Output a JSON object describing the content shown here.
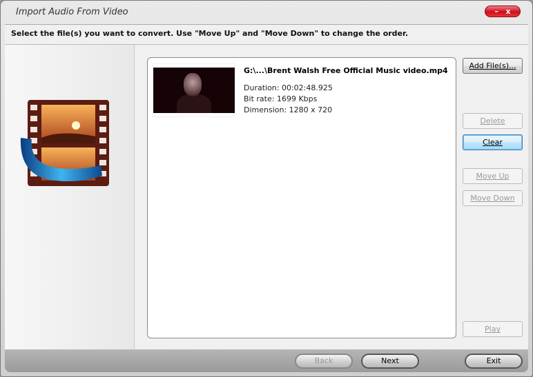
{
  "window": {
    "title": "Import Audio From Video",
    "minimize_label": "–",
    "close_label": "x"
  },
  "instruction": "Select the file(s) you want to convert. Use \"Move Up\" and \"Move Down\" to change the order.",
  "files": [
    {
      "name": "G:\\...\\Brent Walsh  Free Official Music video.mp4",
      "duration": "Duration: 00:02:48.925",
      "bitrate": "Bit rate: 1699 Kbps",
      "dimension": "Dimension: 1280 x 720"
    }
  ],
  "buttons": {
    "add": "Add File(s)...",
    "delete": "Delete",
    "clear": "Clear",
    "move_up": "Move Up",
    "move_down": "Move Down",
    "play": "Play"
  },
  "nav": {
    "back": "Back",
    "next": "Next",
    "exit": "Exit"
  },
  "icons": {
    "logo": "film-strip-audio-icon"
  }
}
